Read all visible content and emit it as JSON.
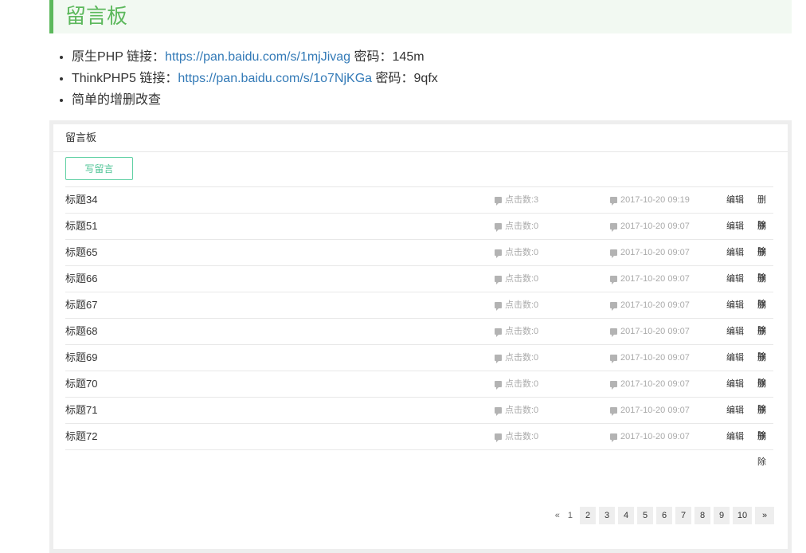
{
  "header": {
    "title": "留言板"
  },
  "info": [
    {
      "prefix": "原生PHP 链接：",
      "link": "https://pan.baidu.com/s/1mjJivag",
      "suffix": " 密码：145m"
    },
    {
      "prefix": "ThinkPHP5 链接：",
      "link": "https://pan.baidu.com/s/1o7NjKGa",
      "suffix": " 密码：9qfx"
    },
    {
      "prefix": "简单的增删改查",
      "link": "",
      "suffix": ""
    }
  ],
  "panel": {
    "title": "留言板",
    "write_label": "写留言",
    "edit_label": "编辑",
    "delete_label": "删除"
  },
  "rows": [
    {
      "title": "标题34",
      "clicks": "点击数:3",
      "date": "2017-10-20 09:19"
    },
    {
      "title": "标题51",
      "clicks": "点击数:0",
      "date": "2017-10-20 09:07"
    },
    {
      "title": "标题65",
      "clicks": "点击数:0",
      "date": "2017-10-20 09:07"
    },
    {
      "title": "标题66",
      "clicks": "点击数:0",
      "date": "2017-10-20 09:07"
    },
    {
      "title": "标题67",
      "clicks": "点击数:0",
      "date": "2017-10-20 09:07"
    },
    {
      "title": "标题68",
      "clicks": "点击数:0",
      "date": "2017-10-20 09:07"
    },
    {
      "title": "标题69",
      "clicks": "点击数:0",
      "date": "2017-10-20 09:07"
    },
    {
      "title": "标题70",
      "clicks": "点击数:0",
      "date": "2017-10-20 09:07"
    },
    {
      "title": "标题71",
      "clicks": "点击数:0",
      "date": "2017-10-20 09:07"
    },
    {
      "title": "标题72",
      "clicks": "点击数:0",
      "date": "2017-10-20 09:07"
    }
  ],
  "pager": {
    "prev": "«",
    "current": "1",
    "pages": [
      "2",
      "3",
      "4",
      "5",
      "6",
      "7",
      "8",
      "9",
      "10"
    ],
    "next": "»"
  },
  "colors": {
    "accent": "#5cb85c",
    "link": "#337ab7",
    "button": "#4cc394"
  }
}
